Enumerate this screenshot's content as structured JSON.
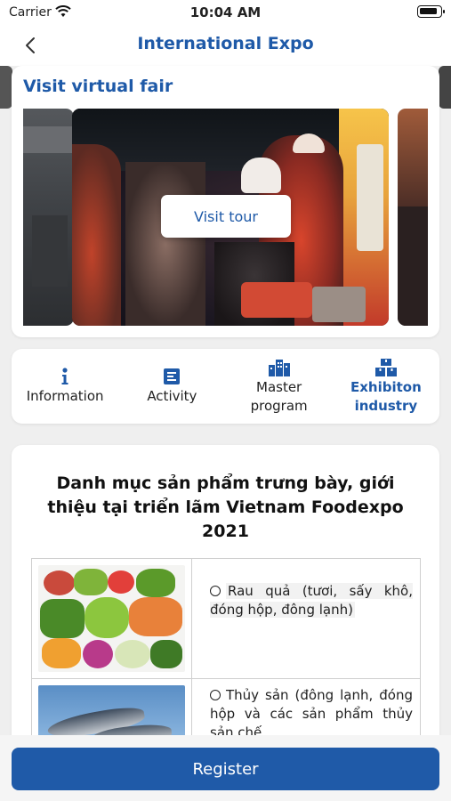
{
  "status_bar": {
    "carrier": "Carrier",
    "time": "10:04 AM"
  },
  "nav": {
    "title": "International Expo",
    "back_icon": "chevron-left-icon"
  },
  "virtual_fair": {
    "title": "Visit virtual fair",
    "button_label": "Visit tour"
  },
  "tabs": [
    {
      "label": "Information",
      "icon": "info-icon",
      "active": false
    },
    {
      "label": "Activity",
      "icon": "list-icon",
      "active": false
    },
    {
      "label": "Master program",
      "icon": "buildings-icon",
      "active": false
    },
    {
      "label": "Exhibiton industry",
      "icon": "boxes-icon",
      "active": true
    }
  ],
  "content": {
    "title": "Danh mục sản phẩm trưng bày, giới thiệu tại triển lãm Vietnam Foodexpo 2021",
    "products": [
      {
        "text": "Rau quả (tươi, sấy khô, đóng hộp, đông lạnh)",
        "image": "vegetables-image"
      },
      {
        "text": "Thủy sản (đông lạnh, đóng hộp và các sản phẩm thủy sản chế",
        "image": "fish-image"
      }
    ]
  },
  "register": {
    "label": "Register"
  },
  "colors": {
    "accent": "#1f5aa8",
    "background": "#efefef",
    "card": "#ffffff"
  }
}
